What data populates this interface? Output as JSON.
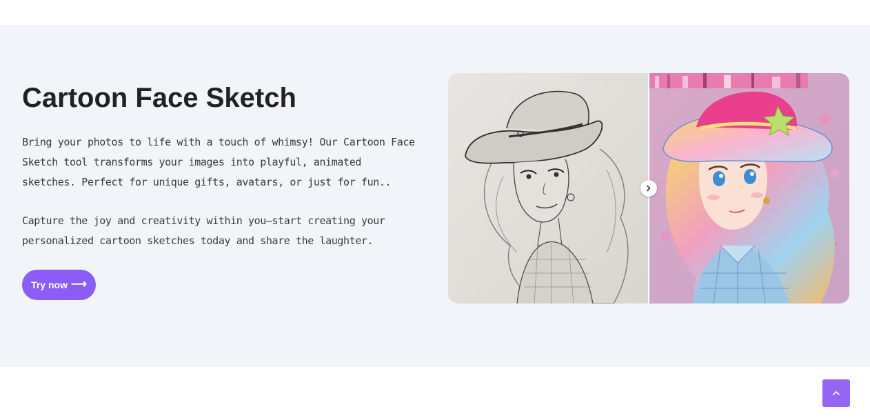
{
  "hero": {
    "title": "Cartoon Face Sketch",
    "paragraph_1": "Bring your photos to life with a touch of whimsy! Our Cartoon Face Sketch tool transforms your images into playful, animated sketches. Perfect for unique gifts, avatars, or just for fun..",
    "paragraph_2": "Capture the joy and creativity within you—start creating your personalized cartoon sketches today and share the laughter.",
    "cta_label": "Try now",
    "cta_icon": "arrow-right-icon"
  },
  "comparison": {
    "before_image": "pencil-sketch-cowgirl",
    "after_image": "colorful-anime-cowgirl",
    "handle_icon": "chevron-right-icon"
  },
  "scroll_top": {
    "icon": "chevron-up-icon"
  },
  "colors": {
    "accent": "#8b5cf6",
    "hero_background": "#f1f4f9",
    "scroll_button": "#9466f2"
  }
}
